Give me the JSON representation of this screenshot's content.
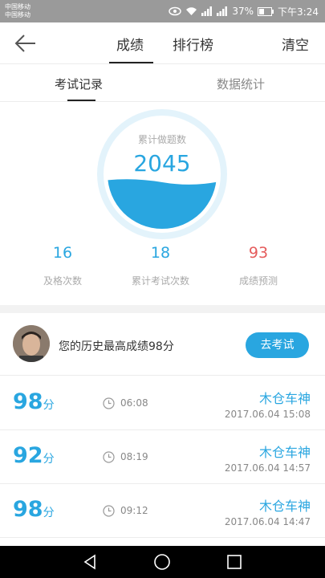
{
  "status_bar": {
    "carrier_1": "中国移动",
    "carrier_2": "中国移动",
    "battery": "37%",
    "time": "下午3:24"
  },
  "header": {
    "back_icon": "back-arrow-icon",
    "tabs": [
      {
        "label": "成绩",
        "active": true
      },
      {
        "label": "排行榜",
        "active": false
      }
    ],
    "clear_label": "清空"
  },
  "subtabs": [
    {
      "label": "考试记录",
      "active": true
    },
    {
      "label": "数据统计",
      "active": false
    }
  ],
  "summary": {
    "label": "累计做题数",
    "value": "2045",
    "accent": "#29a6e0"
  },
  "stats": [
    {
      "value": "16",
      "label": "及格次数",
      "color": "#29a6e0"
    },
    {
      "value": "18",
      "label": "累计考试次数",
      "color": "#29a6e0"
    },
    {
      "value": "93",
      "label": "成绩预测",
      "color": "#e55b5b"
    }
  ],
  "best": {
    "text": "您的历史最高成绩98分",
    "button_label": "去考试"
  },
  "records": [
    {
      "score": "98",
      "unit": "分",
      "duration": "06:08",
      "name": "木仓车神",
      "date": "2017.06.04  15:08"
    },
    {
      "score": "92",
      "unit": "分",
      "duration": "08:19",
      "name": "木仓车神",
      "date": "2017.06.04  14:57"
    },
    {
      "score": "98",
      "unit": "分",
      "duration": "09:12",
      "name": "木仓车神",
      "date": "2017.06.04  14:47"
    }
  ]
}
